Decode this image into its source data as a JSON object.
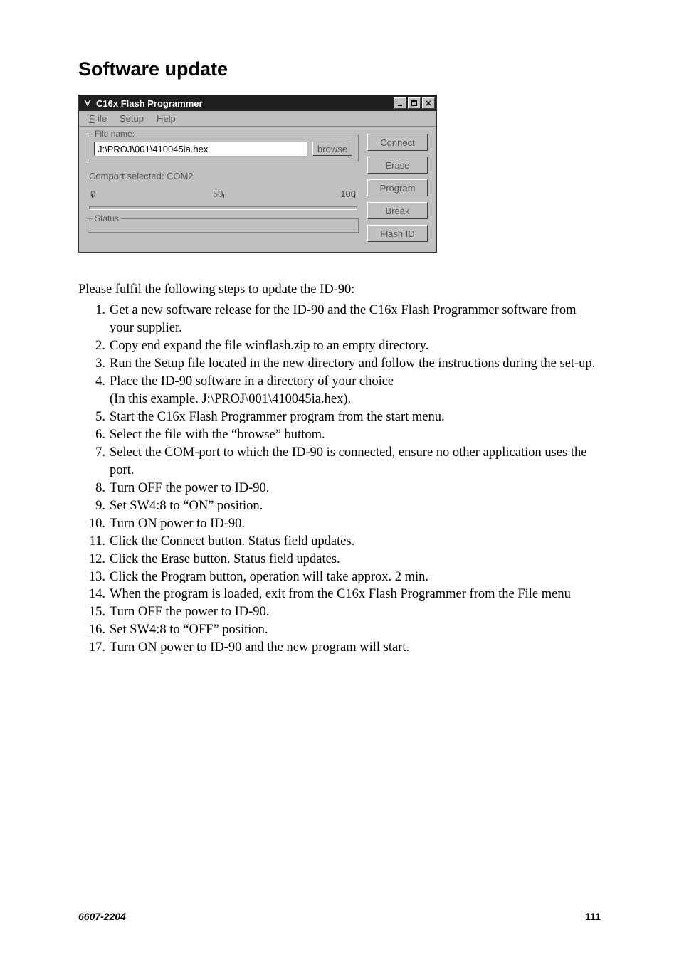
{
  "heading": "Software update",
  "window": {
    "title": "C16x Flash Programmer",
    "menu": {
      "file": "File",
      "setup": "Setup",
      "help": "Help"
    },
    "filename_label": "File name:",
    "filename_value": "J:\\PROJ\\001\\410045ia.hex",
    "browse": "browse",
    "comport": "Comport selected:  COM2",
    "slider": {
      "min": "0",
      "mid": "50",
      "max": "100"
    },
    "status_label": "Status",
    "buttons": {
      "connect": "Connect",
      "erase": "Erase",
      "program": "Program",
      "break": "Break",
      "flashid": "Flash ID"
    }
  },
  "intro": "Please fulfil the following steps to update the ID-90:",
  "steps": [
    "Get a new software release for the ID-90 and the C16x Flash Programmer software from your supplier.",
    "Copy end expand the file winflash.zip to an empty directory.",
    "Run the Setup file located in the new directory and follow the instructions during the set-up.",
    "Place the ID-90 software in a directory of your choice\n(In this example. J:\\PROJ\\001\\410045ia.hex).",
    "Start the C16x Flash Programmer program from the start menu.",
    "Select the file with the “browse” buttom.",
    "Select the COM-port to which the ID-90 is connected, ensure no other application uses the port.",
    "Turn OFF the power to ID-90.",
    "Set SW4:8 to “ON” position.",
    "Turn ON power to ID-90.",
    "Click the Connect button. Status field updates.",
    "Click the Erase button. Status field updates.",
    "Click the Program button, operation will take approx. 2 min.",
    "When the program is loaded, exit from the C16x Flash Programmer from the File menu",
    "Turn OFF the power to ID-90.",
    "Set SW4:8 to “OFF” position.",
    "Turn ON power to ID-90 and the new program will start."
  ],
  "footer": {
    "doc_id": "6607-2204",
    "page": "111"
  }
}
